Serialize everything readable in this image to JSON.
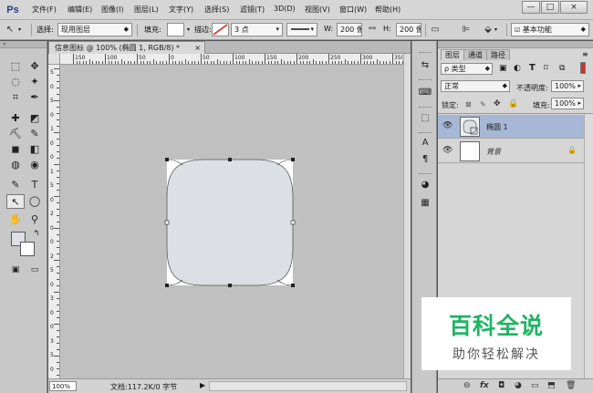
{
  "app": {
    "logo": "Ps",
    "menu": [
      "文件(F)",
      "编辑(E)",
      "图像(I)",
      "图层(L)",
      "文字(Y)",
      "选择(S)",
      "滤镜(T)",
      "3D(D)",
      "视图(V)",
      "窗口(W)",
      "帮助(H)"
    ],
    "window_buttons": [
      "—",
      "□",
      "×"
    ]
  },
  "options": {
    "select_label": "选择:",
    "select_value": "现用图层",
    "fill_label": "填充:",
    "stroke_label": "描边:",
    "stroke_width": "3 点",
    "w_label": "W:",
    "w_value": "200 像",
    "h_label": "H:",
    "h_value": "200 像",
    "workspace": "基本功能"
  },
  "document": {
    "tab_title": "信息图标 @ 100% (椭圆 1, RGB/8) *",
    "close": "×",
    "ruler_h_labels": [
      "150",
      "100",
      "50",
      "0",
      "50",
      "100",
      "150",
      "200",
      "250",
      "300",
      "350",
      "400"
    ],
    "ruler_v_labels": [
      "5",
      "0",
      "5",
      "0",
      "1",
      "0",
      "0",
      "1",
      "5",
      "0",
      "2",
      "0",
      "0",
      "2",
      "5",
      "0",
      "3",
      "0",
      "0",
      "3",
      "5",
      "0"
    ],
    "zoom": "100%",
    "status": "文档:117.2K/0 字节",
    "status_arrow": "▶",
    "canvas_bg": "#c0c0c0",
    "shape_fill": "#dcdfe3"
  },
  "tools": {
    "icons": [
      "⬚",
      "✥",
      "◌",
      "✦",
      "⌗",
      "✒",
      "✚",
      "◩",
      "⛏",
      "✎",
      "◼",
      "◧",
      "◍",
      "◉",
      "✎",
      "T",
      "↖",
      "◯",
      "✋",
      "⚲",
      "▣",
      "▭"
    ]
  },
  "dock": {
    "icons": [
      "⇆",
      "⌨",
      "⬚",
      "A",
      "¶",
      "◕",
      "▦"
    ]
  },
  "layers": {
    "tabs": [
      "图层",
      "通道",
      "路径"
    ],
    "filter_label": "ρ 类型",
    "blend_mode": "正常",
    "opacity_label": "不透明度:",
    "opacity_value": "100%",
    "lock_label": "锁定:",
    "fill_label": "填充:",
    "fill_value": "100%",
    "items": [
      {
        "name": "椭圆 1",
        "selected": true
      },
      {
        "name": "背景",
        "selected": false
      }
    ],
    "bottom_icons": [
      "⊖",
      "fx",
      "◘",
      "◕",
      "▭",
      "⬒",
      "🗑"
    ]
  },
  "watermark": {
    "main": "百科全说",
    "sub": "助你轻松解决"
  }
}
